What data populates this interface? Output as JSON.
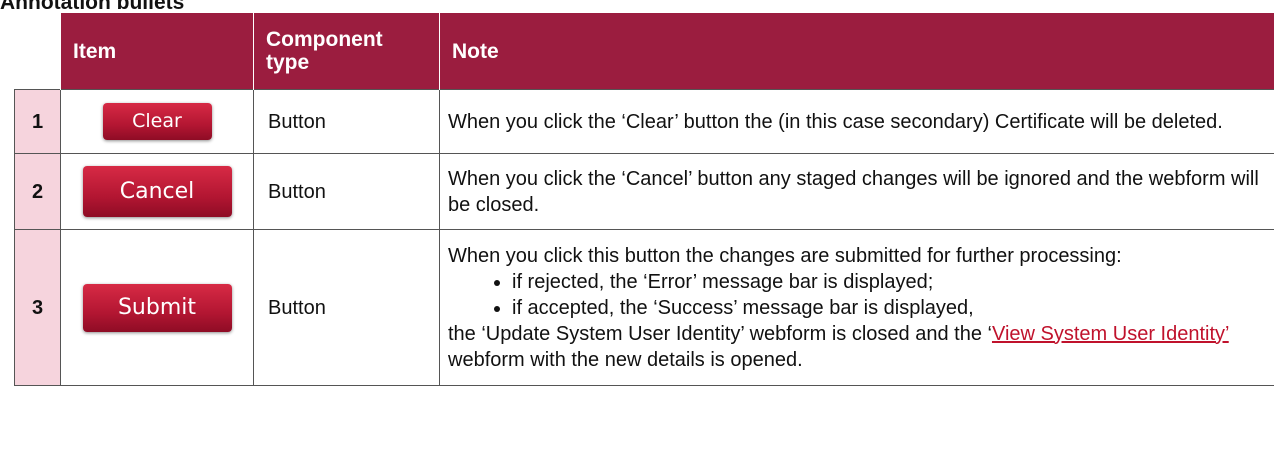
{
  "heading": "Annotation bullets",
  "table": {
    "headers": [
      "Item",
      "Component type",
      "Note"
    ],
    "rows": [
      {
        "num": "1",
        "button_label": "Clear",
        "type": "Button",
        "note": "When you click the ‘Clear’ button the (in this case secondary) Certificate will be deleted."
      },
      {
        "num": "2",
        "button_label": "Cancel",
        "type": "Button",
        "note": "When you click the ‘Cancel’ button any staged changes will be ignored and the webform will be closed."
      },
      {
        "num": "3",
        "button_label": "Submit",
        "type": "Button",
        "note_intro": "When you click this button the changes are submitted for further processing:",
        "bullets": [
          "if rejected, the ‘Error’ message bar is displayed;",
          "if accepted, the ‘Success’ message bar is displayed,"
        ],
        "note_tail_before": "the ‘Update System User Identity’ webform is closed and the ‘",
        "note_link": "View System User Identity’",
        "note_tail_after": " webform with the new details is opened."
      }
    ]
  },
  "colors": {
    "header_bg": "#9b1d3f",
    "number_cell_bg": "#f6d4dd",
    "button_red": "#b31632",
    "link": "#c0122c"
  }
}
